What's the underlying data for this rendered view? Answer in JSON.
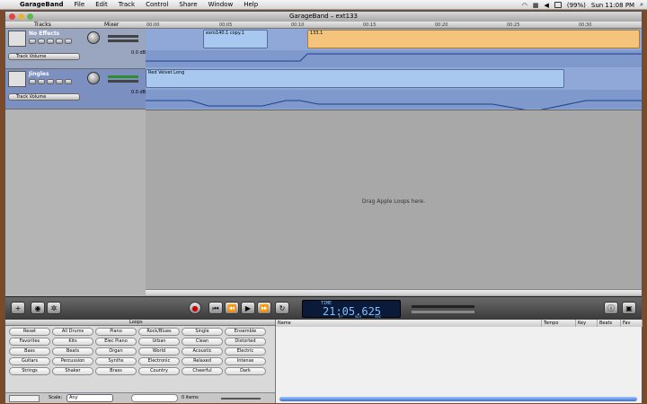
{
  "menubar": {
    "app": "GarageBand",
    "items": [
      "File",
      "Edit",
      "Track",
      "Control",
      "Share",
      "Window",
      "Help"
    ],
    "battery": "(99%)",
    "clock": "Sun 11:08 PM"
  },
  "window": {
    "title": "GarageBand – ext133"
  },
  "header": {
    "tracks": "Tracks",
    "mixer": "Mixer",
    "ticks": [
      "00:00",
      "00:05",
      "00:10",
      "00:15",
      "00:20",
      "00:25",
      "00:30"
    ]
  },
  "tracks": [
    {
      "name": "No Effects",
      "volume_label": "Track Volume",
      "db": "0.0 dB",
      "regions": [
        {
          "name": "exro140.1 copy.1"
        },
        {
          "name": "133.1"
        }
      ]
    },
    {
      "name": "Jingles",
      "volume_label": "Track Volume",
      "db": "0.0 dB",
      "regions": [
        {
          "name": "Red Velvet Long"
        }
      ]
    }
  ],
  "timeline": {
    "drop_hint": "Drag Apple Loops here."
  },
  "transport": {
    "time": "21:05.625",
    "lcd_label": "TIME",
    "lcd_units": [
      "hr",
      "min",
      "sec"
    ]
  },
  "loops": {
    "title": "Loops",
    "keywords": [
      [
        "Reset",
        "All Drums",
        "Piano",
        "Rock/Blues",
        "Single",
        "Ensemble"
      ],
      [
        "Favorites",
        "Kits",
        "Elec Piano",
        "Urban",
        "Clean",
        "Distorted"
      ],
      [
        "Bass",
        "Beats",
        "Organ",
        "World",
        "Acoustic",
        "Electric"
      ],
      [
        "Guitars",
        "Percussion",
        "Synths",
        "Electronic",
        "Relaxed",
        "Intense"
      ],
      [
        "Strings",
        "Shaker",
        "Brass",
        "Country",
        "Cheerful",
        "Dark"
      ]
    ],
    "scale_label": "Scale:",
    "scale_value": "Any",
    "search_placeholder": "",
    "count": "0 items"
  },
  "results": {
    "columns": [
      "Name",
      "Tempo",
      "Key",
      "Beats",
      "Fav"
    ]
  },
  "colors": {
    "timeline": "#8fa8d8",
    "region_blue": "#a9c8f0",
    "region_orange": "#f4c47c"
  }
}
